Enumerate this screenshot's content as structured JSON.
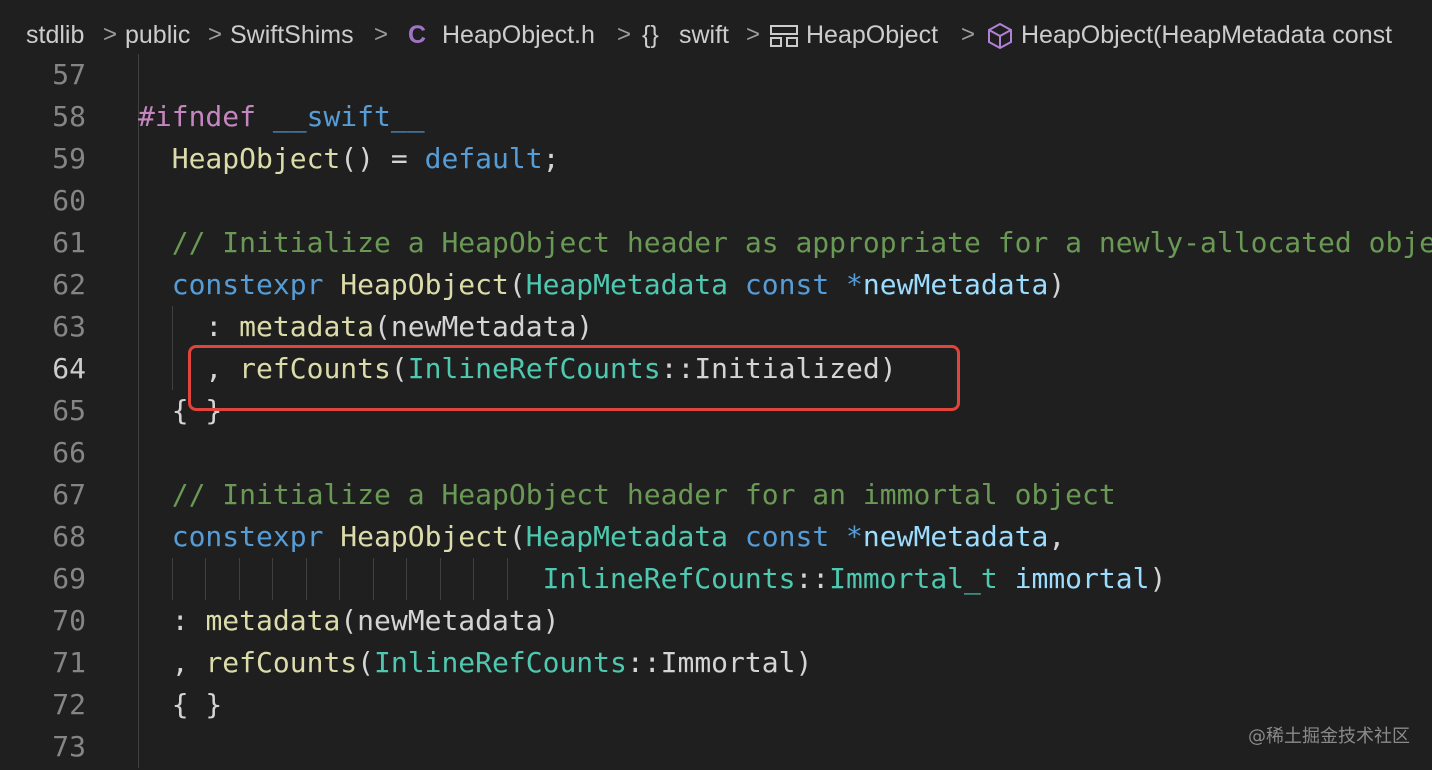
{
  "breadcrumb": {
    "items": [
      "stdlib",
      "public",
      "SwiftShims",
      "HeapObject.h",
      "swift",
      "HeapObject",
      "HeapObject(HeapMetadata const"
    ],
    "chevron": ">",
    "file_icon": "C",
    "namespace_icon": "{}"
  },
  "editor": {
    "lines": [
      {
        "num": "57",
        "tokens": []
      },
      {
        "num": "58",
        "tokens": [
          [
            "#ifndef",
            "pp"
          ],
          [
            " ",
            "pl"
          ],
          [
            "__swift__",
            "mac"
          ]
        ]
      },
      {
        "num": "59",
        "tokens": [
          [
            "  ",
            "pl"
          ],
          [
            "HeapObject",
            "fn"
          ],
          [
            "() = ",
            "pl"
          ],
          [
            "default",
            "kw"
          ],
          [
            ";",
            "pl"
          ]
        ]
      },
      {
        "num": "60",
        "tokens": []
      },
      {
        "num": "61",
        "tokens": [
          [
            "  ",
            "pl"
          ],
          [
            "// Initialize a HeapObject header as appropriate for a newly-allocated obje",
            "cm"
          ]
        ]
      },
      {
        "num": "62",
        "tokens": [
          [
            "  ",
            "pl"
          ],
          [
            "constexpr",
            "kw"
          ],
          [
            " ",
            "pl"
          ],
          [
            "HeapObject",
            "fn"
          ],
          [
            "(",
            "pl"
          ],
          [
            "HeapMetadata",
            "ty"
          ],
          [
            " ",
            "pl"
          ],
          [
            "const",
            "kw"
          ],
          [
            " ",
            "pl"
          ],
          [
            "*",
            "kw"
          ],
          [
            "newMetadata",
            "var"
          ],
          [
            ")",
            "pl"
          ]
        ]
      },
      {
        "num": "63",
        "tokens": [
          [
            "    : ",
            "pl"
          ],
          [
            "metadata",
            "fn"
          ],
          [
            "(newMetadata)",
            "pl"
          ]
        ]
      },
      {
        "num": "64",
        "tokens": [
          [
            "    , ",
            "pl"
          ],
          [
            "refCounts",
            "fn"
          ],
          [
            "(",
            "pl"
          ],
          [
            "InlineRefCounts",
            "ty"
          ],
          [
            "::Initialized)",
            "pl"
          ]
        ]
      },
      {
        "num": "65",
        "tokens": [
          [
            "  { }",
            "pl"
          ]
        ]
      },
      {
        "num": "66",
        "tokens": []
      },
      {
        "num": "67",
        "tokens": [
          [
            "  ",
            "pl"
          ],
          [
            "// Initialize a HeapObject header for an immortal object",
            "cm"
          ]
        ]
      },
      {
        "num": "68",
        "tokens": [
          [
            "  ",
            "pl"
          ],
          [
            "constexpr",
            "kw"
          ],
          [
            " ",
            "pl"
          ],
          [
            "HeapObject",
            "fn"
          ],
          [
            "(",
            "pl"
          ],
          [
            "HeapMetadata",
            "ty"
          ],
          [
            " ",
            "pl"
          ],
          [
            "const",
            "kw"
          ],
          [
            " ",
            "pl"
          ],
          [
            "*",
            "kw"
          ],
          [
            "newMetadata",
            "var"
          ],
          [
            ",",
            "pl"
          ]
        ]
      },
      {
        "num": "69",
        "tokens": [
          [
            "                        ",
            "pl"
          ],
          [
            "InlineRefCounts",
            "ty"
          ],
          [
            "::",
            "pl"
          ],
          [
            "Immortal_t",
            "ty"
          ],
          [
            " ",
            "pl"
          ],
          [
            "immortal",
            "var"
          ],
          [
            ")",
            "pl"
          ]
        ]
      },
      {
        "num": "70",
        "tokens": [
          [
            "  : ",
            "pl"
          ],
          [
            "metadata",
            "fn"
          ],
          [
            "(newMetadata)",
            "pl"
          ]
        ]
      },
      {
        "num": "71",
        "tokens": [
          [
            "  , ",
            "pl"
          ],
          [
            "refCounts",
            "fn"
          ],
          [
            "(",
            "pl"
          ],
          [
            "InlineRefCounts",
            "ty"
          ],
          [
            "::Immortal)",
            "pl"
          ]
        ]
      },
      {
        "num": "72",
        "tokens": [
          [
            "  { }",
            "pl"
          ]
        ]
      },
      {
        "num": "73",
        "tokens": []
      }
    ],
    "active_line": "64"
  },
  "annotation": {
    "color": "#e0443a",
    "target_line": "64"
  },
  "watermark": "@稀土掘金技术社区",
  "colors": {
    "background": "#1f1f1f",
    "preprocessor": "#c586c0",
    "keyword": "#569cd6",
    "function": "#dcdcaa",
    "type": "#4ec9b0",
    "variable": "#9cdcfe",
    "comment": "#6a9955"
  }
}
